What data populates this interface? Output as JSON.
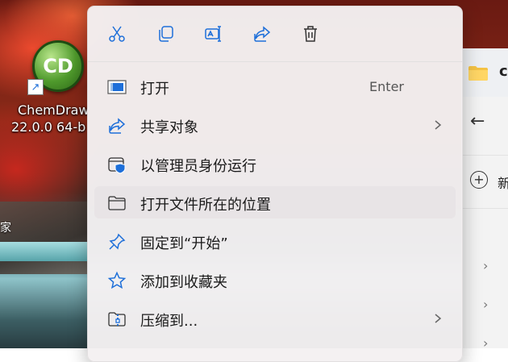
{
  "desktop": {
    "icon": {
      "name": "cd-logo",
      "logo_text": "CD",
      "label_line1": "ChemDraw",
      "label_line2": "22.0.0 64-b"
    },
    "fragment_text": "家"
  },
  "explorer": {
    "title_fragment": "cl",
    "new_fragment": "新"
  },
  "context_menu": {
    "toolbar": [
      {
        "name": "cut",
        "icon": "scissors-icon"
      },
      {
        "name": "copy",
        "icon": "copy-icon"
      },
      {
        "name": "rename",
        "icon": "rename-icon"
      },
      {
        "name": "share",
        "icon": "share-icon"
      },
      {
        "name": "delete",
        "icon": "trash-icon"
      }
    ],
    "items": [
      {
        "label": "打开",
        "shortcut": "Enter",
        "icon": "open-window-icon",
        "submenu": false
      },
      {
        "label": "共享对象",
        "shortcut": "",
        "icon": "share-icon",
        "submenu": true
      },
      {
        "label": "以管理员身份运行",
        "shortcut": "",
        "icon": "admin-shield-icon",
        "submenu": false
      },
      {
        "label": "打开文件所在的位置",
        "shortcut": "",
        "icon": "folder-icon",
        "submenu": false,
        "highlighted": true
      },
      {
        "label": "固定到“开始”",
        "shortcut": "",
        "icon": "pin-icon",
        "submenu": false
      },
      {
        "label": "添加到收藏夹",
        "shortcut": "",
        "icon": "star-icon",
        "submenu": false
      },
      {
        "label": "压缩到...",
        "shortcut": "",
        "icon": "zip-icon",
        "submenu": true
      }
    ]
  },
  "colors": {
    "accent": "#1e6fd9",
    "menu_bg": "#f4f1f2",
    "hover_bg": "#e8e4e6"
  }
}
